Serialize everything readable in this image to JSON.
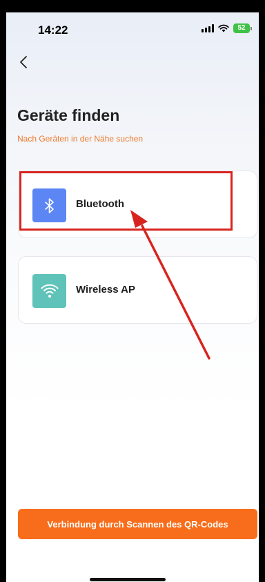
{
  "status_bar": {
    "time": "14:22",
    "battery": "52",
    "battery_color": "#3fc246",
    "icons": [
      "signal-icon",
      "wifi-icon",
      "battery-icon"
    ]
  },
  "nav": {
    "back_icon": "chevron-left-icon"
  },
  "header": {
    "title": "Geräte finden",
    "subtitle": "Nach Geräten in der Nähe suchen"
  },
  "options": [
    {
      "label": "Bluetooth",
      "icon": "bluetooth-icon",
      "icon_color": "#5b86f4"
    },
    {
      "label": "Wireless AP",
      "icon": "wifi-icon",
      "icon_color": "#5fc3b9"
    }
  ],
  "annotation": {
    "highlight_color": "#d8241e"
  },
  "footer": {
    "scan_button_label": "Verbindung durch Scannen des QR-Codes",
    "button_color": "#f76d1b"
  },
  "colors": {
    "accent_orange": "#ef7a2c"
  }
}
